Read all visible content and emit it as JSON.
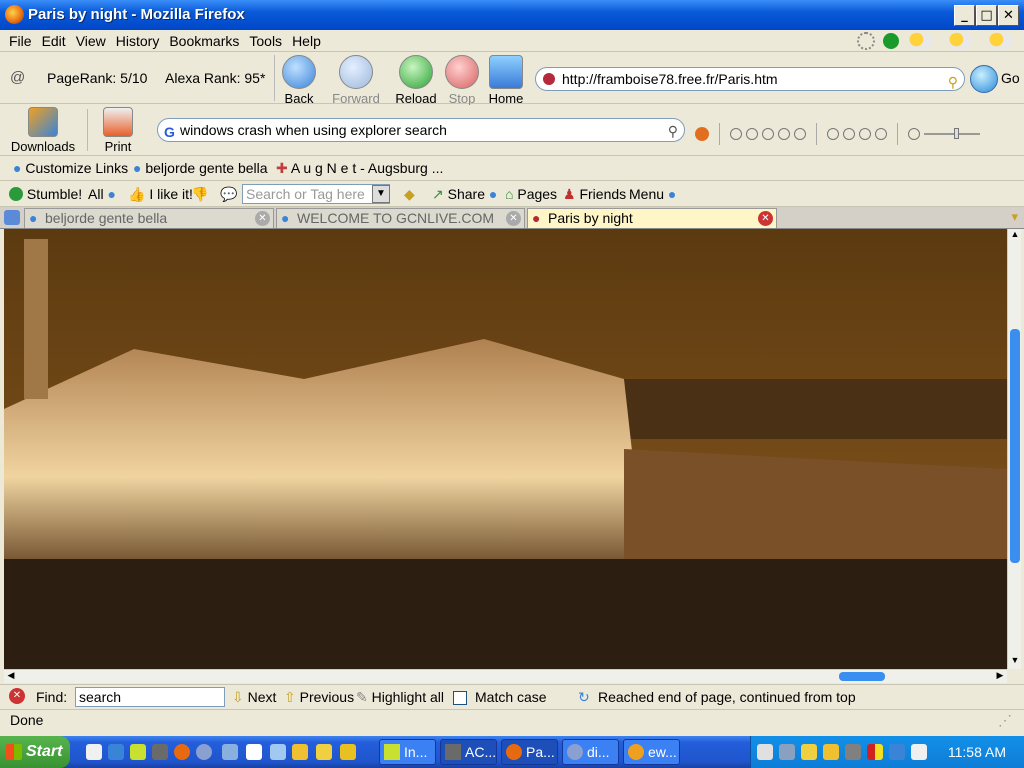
{
  "window": {
    "title": "Paris by night - Mozilla Firefox"
  },
  "menu": [
    "File",
    "Edit",
    "View",
    "History",
    "Bookmarks",
    "Tools",
    "Help"
  ],
  "nav": {
    "pagerank": "PageRank: 5/10",
    "alexa": "Alexa Rank: 95*",
    "back": "Back",
    "forward": "Forward",
    "reload": "Reload",
    "stop": "Stop",
    "home": "Home",
    "url": "http://framboise78.free.fr/Paris.htm",
    "go": "Go"
  },
  "search_toolbar": {
    "downloads": "Downloads",
    "print": "Print",
    "query": "windows crash when using explorer search"
  },
  "links": [
    {
      "label": "Customize Links"
    },
    {
      "label": "beljorde gente bella"
    },
    {
      "label": "A u g N e t - Augsburg ..."
    }
  ],
  "stumble": {
    "stumble": "Stumble!",
    "all": "All",
    "like": "I like it!",
    "search_placeholder": "Search or Tag here",
    "share": "Share",
    "pages": "Pages",
    "friends": "Friends",
    "menu": "Menu"
  },
  "tabs": [
    {
      "label": "beljorde gente bella",
      "active": false
    },
    {
      "label": "WELCOME TO GCNLIVE.COM",
      "active": false
    },
    {
      "label": "Paris by night",
      "active": true
    }
  ],
  "content": {
    "image_description_alt": ""
  },
  "find": {
    "label": "Find:",
    "value": "search",
    "next": "Next",
    "previous": "Previous",
    "highlight": "Highlight all",
    "match_case": "Match case",
    "message": "Reached end of page, continued from top"
  },
  "status": {
    "text": "Done"
  },
  "taskbar": {
    "start": "Start",
    "tasks": [
      {
        "label": "In..."
      },
      {
        "label": "AC..."
      },
      {
        "label": "Pa..."
      },
      {
        "label": "di..."
      },
      {
        "label": "ew..."
      }
    ],
    "clock": "11:58 AM"
  },
  "colors": {
    "titlebar": "#0a5ad8",
    "chrome": "#ece9d8",
    "active_tab": "#fff6c8",
    "taskbar": "#245edb",
    "start": "#3a9232"
  }
}
